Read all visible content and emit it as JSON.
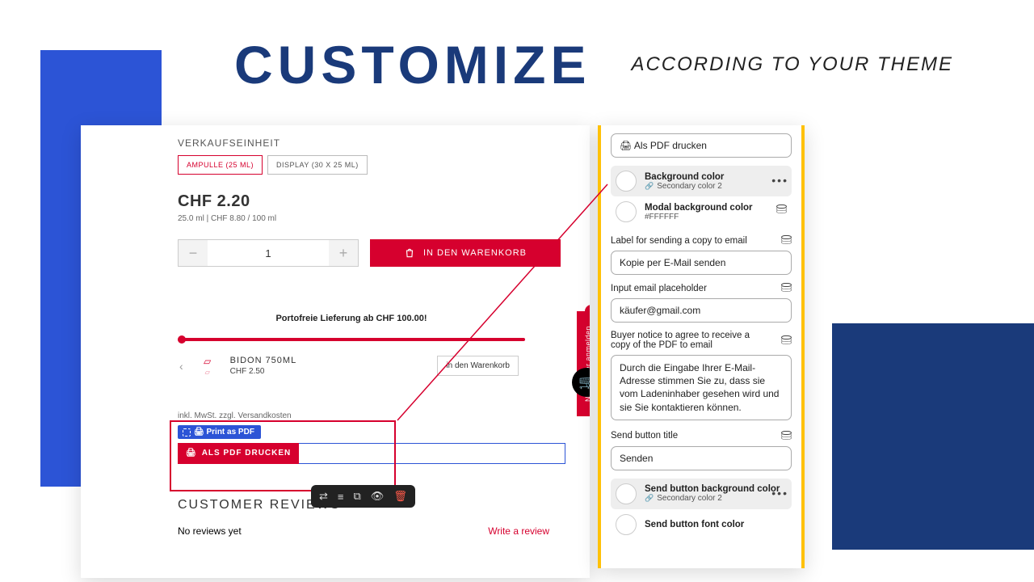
{
  "hero": {
    "title": "CUSTOMIZE",
    "subtitle": "ACCORDING TO YOUR THEME"
  },
  "preview": {
    "section_label": "VERKAUFSEINHEIT",
    "variants": [
      {
        "label": "AMPULLE (25 ML)",
        "active": true
      },
      {
        "label": "DISPLAY (30 X 25 ML)",
        "active": false
      }
    ],
    "price": "CHF 2.20",
    "price_unit": "25.0 ml | CHF 8.80 / 100 ml",
    "qty_value": "1",
    "add_to_cart": "IN DEN WARENKORB",
    "free_shipping": "Portofreie Lieferung ab CHF 100.00!",
    "related": {
      "name": "BIDON 750ML",
      "price": "CHF 2.50",
      "mini_btn": "in den Warenkorb"
    },
    "newsletter_tab": "Newsletter anmelden",
    "tax_note": "inkl. MwSt. zzgl. Versandkosten",
    "theme_badge": "🖨 Print as PDF",
    "pdf_button": "ALS PDF DRUCKEN",
    "reviews_heading": "CUSTOMER REVIEWS",
    "no_reviews": "No reviews yet",
    "write_review": "Write a review"
  },
  "settings": {
    "top_input_value": "🖨 Als PDF drucken",
    "bg_color": {
      "title": "Background color",
      "sub": "Secondary color 2"
    },
    "modal_bg": {
      "title": "Modal background color",
      "sub": "#FFFFFF"
    },
    "label_email": {
      "label": "Label for sending a copy to email",
      "value": "Kopie per E-Mail senden"
    },
    "placeholder": {
      "label": "Input email placeholder",
      "value": "käufer@gmail.com"
    },
    "notice": {
      "label": "Buyer notice to agree to receive a copy of the PDF to email",
      "value": "Durch die Eingabe Ihrer E-Mail-Adresse stimmen Sie zu, dass sie vom Ladeninhaber gesehen wird und sie Sie kontaktieren können."
    },
    "send_title": {
      "label": "Send button title",
      "value": "Senden"
    },
    "send_bg": {
      "title": "Send button background color",
      "sub": "Secondary color 2"
    },
    "send_font": {
      "title": "Send button font color"
    }
  }
}
